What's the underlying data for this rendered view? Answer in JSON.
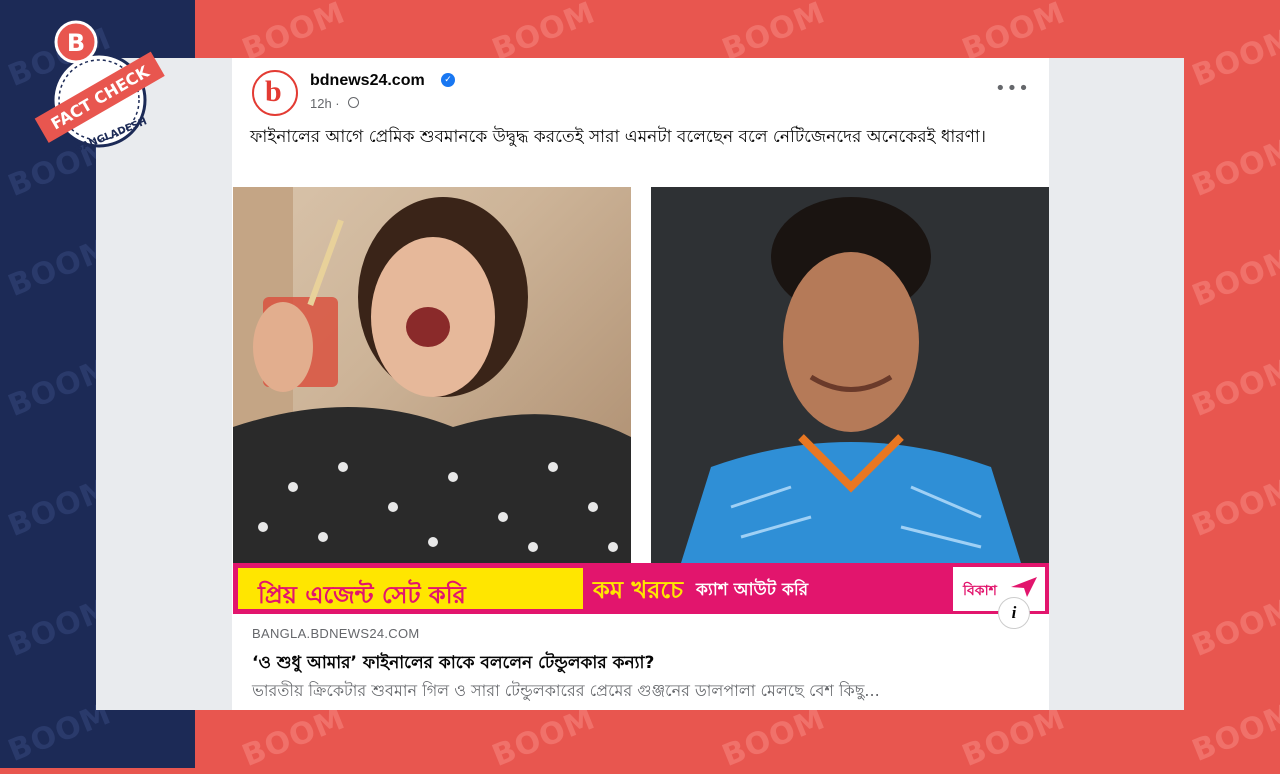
{
  "page": {
    "brand_colors": {
      "navy": "#1c2a56",
      "red": "#e8564f",
      "ad_pink": "#e2156d",
      "ad_yellow": "#ffe600",
      "fb_blue": "#1877f2"
    },
    "watermark_text": "BOOM"
  },
  "logo": {
    "letter": "B",
    "banner": "FACT CHECK",
    "country": "BANGLADESH"
  },
  "post": {
    "page_name": "bdnews24.com",
    "avatar_letter": "b",
    "verified_icon": "verified-badge-icon",
    "time": "12h ·",
    "audience_icon": "globe-icon",
    "more_label": "•••",
    "text": "ফাইনালের আগে প্রেমিক শুবমানকে উদ্বুদ্ধ করতেই সারা এমনটা বলেছেন বলে নেটিজেনদের অনেকেরই ধারণা।"
  },
  "ad": {
    "text1": "প্রিয় এজেন্ট সেট করি",
    "text2": "কম খরচে",
    "text3": "ক্যাশ আউট করি",
    "brand": "বিকাশ"
  },
  "link": {
    "info_label": "i",
    "domain": "BANGLA.BDNEWS24.COM",
    "headline": "‘ও শুধু আমার’ ফাইনালের কাকে বললেন টেন্ডুলকার কন্যা?",
    "description": "ভারতীয় ক্রিকেটার শুবমান গিল ও সারা টেন্ডুলকারের প্রেমের গুঞ্জনের ডালপালা মেলছে বেশ কিছু..."
  }
}
